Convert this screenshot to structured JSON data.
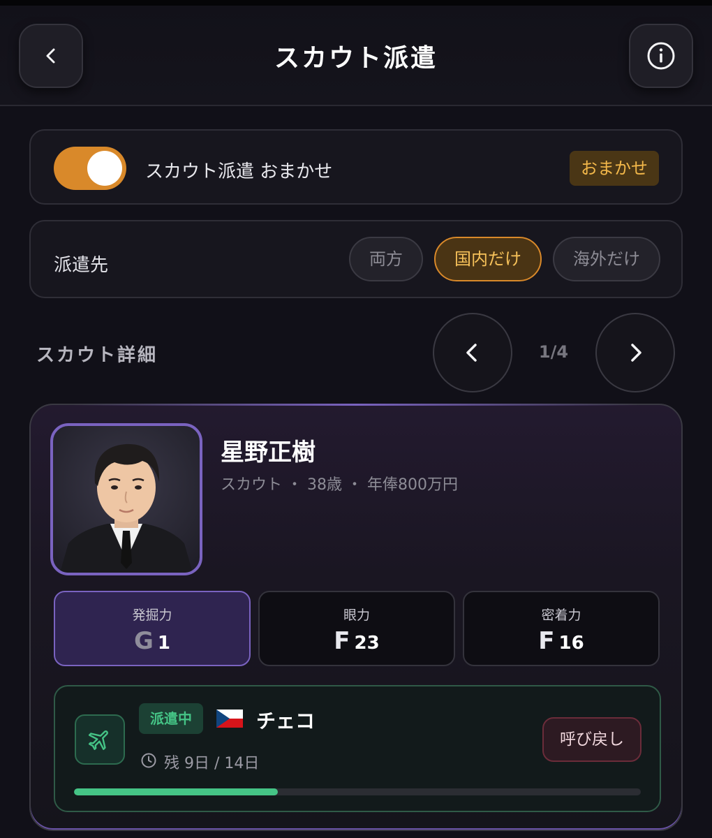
{
  "header": {
    "title": "スカウト派遣"
  },
  "auto": {
    "toggle_on": true,
    "label": "スカウト派遣 おまかせ",
    "badge": "おまかせ"
  },
  "destination": {
    "label": "派遣先",
    "options": [
      "両方",
      "国内だけ",
      "海外だけ"
    ],
    "selected": "国内だけ"
  },
  "details": {
    "section_title": "スカウト詳細",
    "pager": "1/4"
  },
  "scout": {
    "name": "星野正樹",
    "meta": "スカウト ・ 38歳 ・ 年俸800万円",
    "stats": [
      {
        "label": "発掘力",
        "grade": "G",
        "value": "1"
      },
      {
        "label": "眼力",
        "grade": "F",
        "value": "23"
      },
      {
        "label": "密着力",
        "grade": "F",
        "value": "16"
      }
    ]
  },
  "dispatch": {
    "status": "派遣中",
    "country": "チェコ",
    "remaining": "残 9日 / 14日",
    "recall_label": "呼び戻し",
    "progress": 0.36
  },
  "colors": {
    "accent_orange": "#d9892a",
    "accent_purple": "#7a63c0",
    "accent_green": "#45c486"
  },
  "icons": [
    "chevron-left-icon",
    "info-icon",
    "chevron-right-icon",
    "airplane-icon",
    "czech-flag-icon",
    "clock-icon"
  ]
}
